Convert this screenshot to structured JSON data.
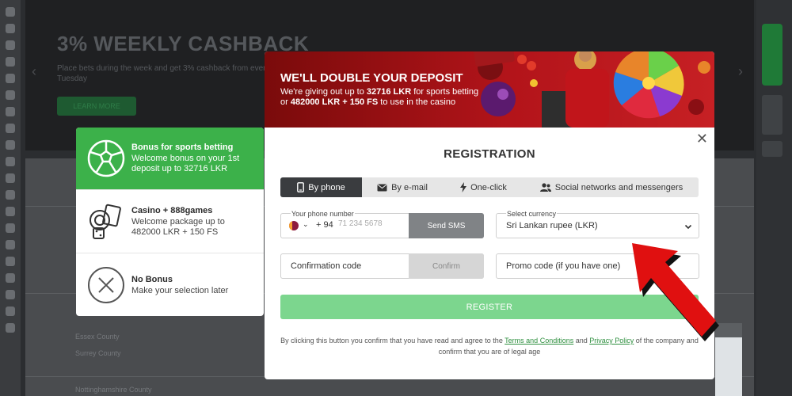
{
  "background": {
    "banner_title": "3% WEEKLY CASHBACK",
    "banner_sub": "Place bets during the week and get 3% cashback from every Tuesday",
    "banner_button": "LEARN MORE",
    "rows": [
      "Essex County",
      "Surrey County",
      "Nottinghamshire County"
    ]
  },
  "bonus_panel": {
    "items": [
      {
        "icon": "soccer-ball-icon",
        "title": "Bonus for sports betting",
        "desc": "Welcome bonus on your 1st deposit up to 32716 LKR",
        "active": true
      },
      {
        "icon": "casino-chips-icon",
        "title": "Casino + 888games",
        "desc": "Welcome package up to 482000 LKR + 150 FS",
        "active": false
      },
      {
        "icon": "no-bonus-icon",
        "title": "No Bonus",
        "desc": "Make your selection later",
        "active": false
      }
    ]
  },
  "hero": {
    "title": "WE'LL DOUBLE YOUR DEPOSIT",
    "line1_prefix": "We're giving out up to ",
    "line1_amount": "32716 LKR",
    "line1_suffix": " for sports betting",
    "line2_prefix": "or ",
    "line2_amount": "482000 LKR + 150 FS",
    "line2_suffix": " to use in the casino"
  },
  "registration": {
    "close": "✕",
    "title": "REGISTRATION",
    "tabs": [
      {
        "label": "By phone",
        "icon": "phone-icon",
        "active": true
      },
      {
        "label": "By e-mail",
        "icon": "envelope-icon",
        "active": false
      },
      {
        "label": "One-click",
        "icon": "lightning-icon",
        "active": false
      },
      {
        "label": "Social networks and messengers",
        "icon": "people-icon",
        "active": false
      }
    ],
    "phone": {
      "label": "Your phone number",
      "country_code": "+ 94",
      "placeholder": "71 234 5678",
      "sms_button": "Send SMS"
    },
    "currency": {
      "label": "Select currency",
      "value": "Sri Lankan rupee (LKR)"
    },
    "confirmation": {
      "placeholder": "Confirmation code",
      "button": "Confirm"
    },
    "promo": {
      "placeholder": "Promo code (if you have one)"
    },
    "register_button": "REGISTER",
    "terms": {
      "prefix": "By clicking this button you confirm that you have read and agree to the ",
      "link1": "Terms and Conditions",
      "middle": " and ",
      "link2": "Privacy Policy",
      "suffix": " of the company and confirm that you are of legal age"
    }
  },
  "colors": {
    "accent_green": "#3cb14a",
    "register_green": "#7cd68e",
    "hero_red": "#b3141a",
    "arrow_red": "#e01010"
  }
}
